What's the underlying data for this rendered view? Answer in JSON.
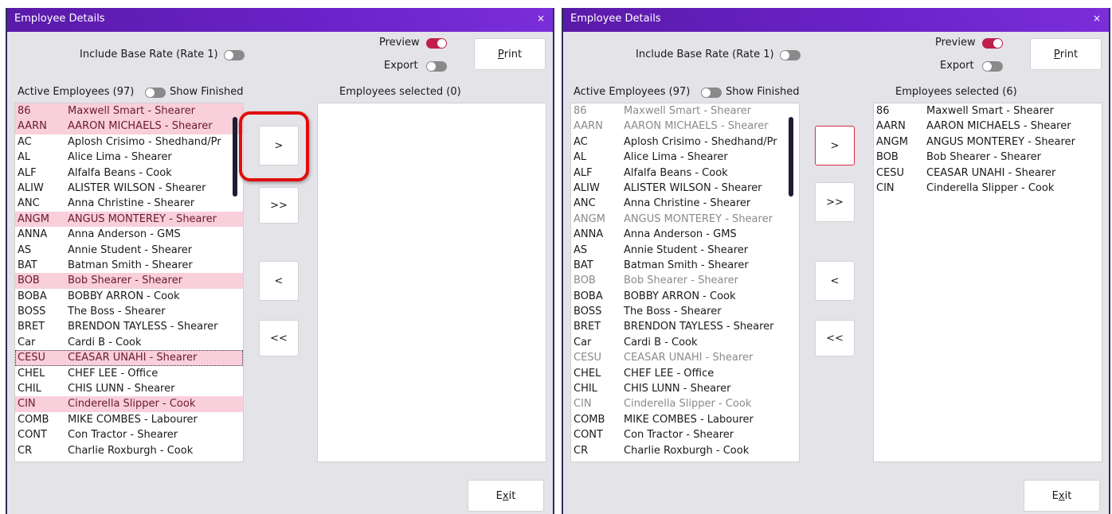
{
  "windows": [
    {
      "title": "Employee Details",
      "close_glyph": "×",
      "include_base_rate_label": "Include Base Rate (Rate 1)",
      "include_base_rate_on": false,
      "preview_label": "Preview",
      "preview_on": true,
      "export_label": "Export",
      "export_on": false,
      "print_label_before": "",
      "print_label_underlined": "P",
      "print_label_after": "rint",
      "active_employees_label": "Active Employees (97)",
      "show_finished_label": "Show Finished",
      "show_finished_on": false,
      "employees_selected_label": "Employees selected  (0)",
      "move_one_right_label": ">",
      "move_all_right_label": ">>",
      "move_one_left_label": "<",
      "move_all_left_label": "<<",
      "exit_label_before": "E",
      "exit_label_underlined": "x",
      "exit_label_after": "it",
      "highlighted_control": "move-one-right-button",
      "active_list": [
        {
          "code": "86",
          "name": "Maxwell Smart - Shearer",
          "state": "selected"
        },
        {
          "code": "AARN",
          "name": "AARON MICHAELS - Shearer",
          "state": "selected"
        },
        {
          "code": "AC",
          "name": "Aplosh Crisimo - Shedhand/Pr",
          "state": "normal"
        },
        {
          "code": "AL",
          "name": "Alice Lima - Shearer",
          "state": "normal"
        },
        {
          "code": "ALF",
          "name": "Alfalfa Beans - Cook",
          "state": "normal"
        },
        {
          "code": "ALIW",
          "name": "ALISTER WILSON - Shearer",
          "state": "normal"
        },
        {
          "code": "ANC",
          "name": "Anna Christine - Shearer",
          "state": "normal"
        },
        {
          "code": "ANGM",
          "name": "ANGUS MONTEREY - Shearer",
          "state": "selected"
        },
        {
          "code": "ANNA",
          "name": "Anna Anderson - GMS",
          "state": "normal"
        },
        {
          "code": "AS",
          "name": "Annie Student - Shearer",
          "state": "normal"
        },
        {
          "code": "BAT",
          "name": "Batman Smith - Shearer",
          "state": "normal"
        },
        {
          "code": "BOB",
          "name": "Bob Shearer - Shearer",
          "state": "selected"
        },
        {
          "code": "BOBA",
          "name": "BOBBY ARRON - Cook",
          "state": "normal"
        },
        {
          "code": "BOSS",
          "name": " The Boss - Shearer",
          "state": "normal"
        },
        {
          "code": "BRET",
          "name": "BRENDON TAYLESS - Shearer",
          "state": "normal"
        },
        {
          "code": "Car",
          "name": "Cardi B - Cook",
          "state": "normal"
        },
        {
          "code": "CESU",
          "name": "CEASAR UNAHI - Shearer",
          "state": "selected-focused"
        },
        {
          "code": "CHEL",
          "name": "CHEF LEE - Office",
          "state": "normal"
        },
        {
          "code": "CHIL",
          "name": "CHIS LUNN - Shearer",
          "state": "normal"
        },
        {
          "code": "CIN",
          "name": "Cinderella Slipper - Cook",
          "state": "selected"
        },
        {
          "code": "COMB",
          "name": "MIKE COMBES - Labourer",
          "state": "normal"
        },
        {
          "code": "CONT",
          "name": "Con Tractor - Shearer",
          "state": "normal"
        },
        {
          "code": "CR",
          "name": "Charlie Roxburgh - Cook",
          "state": "normal"
        }
      ],
      "selected_list": []
    },
    {
      "title": "Employee Details",
      "close_glyph": "×",
      "include_base_rate_label": "Include Base Rate (Rate 1)",
      "include_base_rate_on": false,
      "preview_label": "Preview",
      "preview_on": true,
      "export_label": "Export",
      "export_on": false,
      "print_label_before": "",
      "print_label_underlined": "P",
      "print_label_after": "rint",
      "active_employees_label": "Active Employees (97)",
      "show_finished_label": "Show Finished",
      "show_finished_on": false,
      "employees_selected_label": "Employees selected  (6)",
      "move_one_right_label": ">",
      "move_all_right_label": ">>",
      "move_one_left_label": "<",
      "move_all_left_label": "<<",
      "exit_label_before": "E",
      "exit_label_underlined": "x",
      "exit_label_after": "it",
      "highlighted_control": "",
      "active_list": [
        {
          "code": "86",
          "name": "Maxwell Smart - Shearer",
          "state": "dim"
        },
        {
          "code": "AARN",
          "name": "AARON MICHAELS - Shearer",
          "state": "dim"
        },
        {
          "code": "AC",
          "name": "Aplosh Crisimo - Shedhand/Pr",
          "state": "normal"
        },
        {
          "code": "AL",
          "name": "Alice Lima - Shearer",
          "state": "normal"
        },
        {
          "code": "ALF",
          "name": "Alfalfa Beans - Cook",
          "state": "normal"
        },
        {
          "code": "ALIW",
          "name": "ALISTER WILSON - Shearer",
          "state": "normal"
        },
        {
          "code": "ANC",
          "name": "Anna Christine - Shearer",
          "state": "normal"
        },
        {
          "code": "ANGM",
          "name": "ANGUS MONTEREY - Shearer",
          "state": "dim"
        },
        {
          "code": "ANNA",
          "name": "Anna Anderson - GMS",
          "state": "normal"
        },
        {
          "code": "AS",
          "name": "Annie Student - Shearer",
          "state": "normal"
        },
        {
          "code": "BAT",
          "name": "Batman Smith - Shearer",
          "state": "normal"
        },
        {
          "code": "BOB",
          "name": "Bob Shearer - Shearer",
          "state": "dim"
        },
        {
          "code": "BOBA",
          "name": "BOBBY ARRON - Cook",
          "state": "normal"
        },
        {
          "code": "BOSS",
          "name": " The Boss - Shearer",
          "state": "normal"
        },
        {
          "code": "BRET",
          "name": "BRENDON TAYLESS - Shearer",
          "state": "normal"
        },
        {
          "code": "Car",
          "name": "Cardi B - Cook",
          "state": "normal"
        },
        {
          "code": "CESU",
          "name": "CEASAR UNAHI - Shearer",
          "state": "dim"
        },
        {
          "code": "CHEL",
          "name": "CHEF LEE - Office",
          "state": "normal"
        },
        {
          "code": "CHIL",
          "name": "CHIS LUNN - Shearer",
          "state": "normal"
        },
        {
          "code": "CIN",
          "name": "Cinderella Slipper - Cook",
          "state": "dim"
        },
        {
          "code": "COMB",
          "name": "MIKE COMBES - Labourer",
          "state": "normal"
        },
        {
          "code": "CONT",
          "name": "Con Tractor - Shearer",
          "state": "normal"
        },
        {
          "code": "CR",
          "name": "Charlie Roxburgh - Cook",
          "state": "normal"
        }
      ],
      "selected_list": [
        {
          "code": "86",
          "name": "Maxwell Smart - Shearer"
        },
        {
          "code": "AARN",
          "name": "AARON MICHAELS - Shearer"
        },
        {
          "code": "ANGM",
          "name": "ANGUS MONTEREY - Shearer"
        },
        {
          "code": "BOB",
          "name": "Bob Shearer - Shearer"
        },
        {
          "code": "CESU",
          "name": "CEASAR UNAHI - Shearer"
        },
        {
          "code": "CIN",
          "name": "Cinderella Slipper - Cook"
        }
      ]
    }
  ]
}
